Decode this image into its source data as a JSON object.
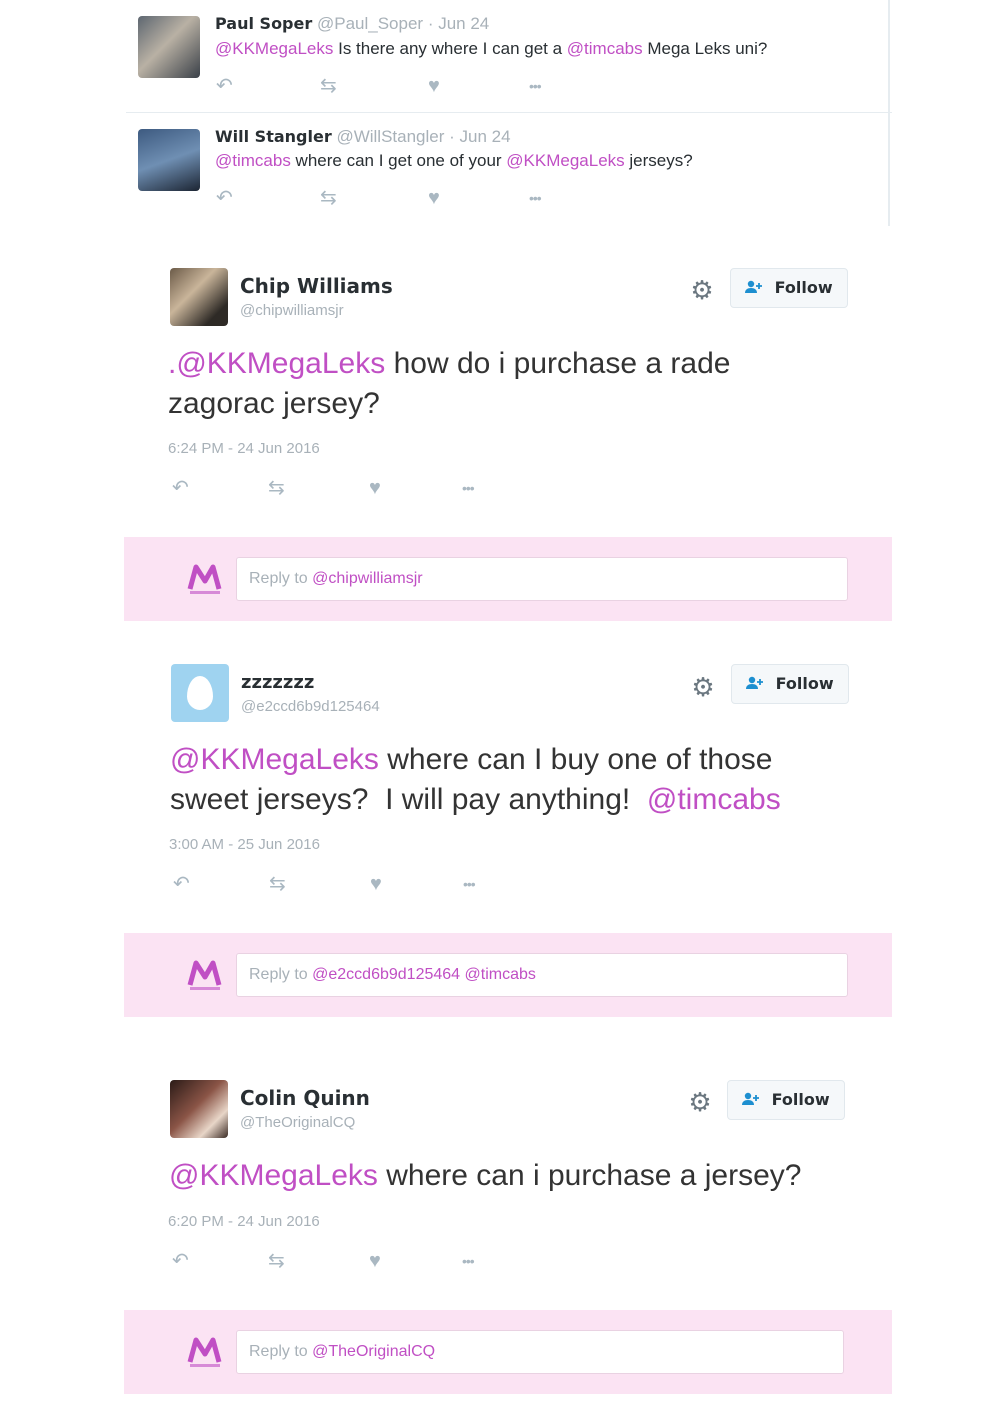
{
  "compact_tweets": [
    {
      "name": "Paul Soper",
      "handle": "@Paul_Soper",
      "date": "· Jun 24",
      "parts": [
        {
          "t": "@KKMegaLeks",
          "m": true
        },
        {
          "t": " Is there any where I can get a ",
          "m": false
        },
        {
          "t": "@timcabs",
          "m": true
        },
        {
          "t": " Mega Leks uni?",
          "m": false
        }
      ]
    },
    {
      "name": "Will Stangler",
      "handle": "@WillStangler",
      "date": "· Jun 24",
      "parts": [
        {
          "t": "@timcabs",
          "m": true
        },
        {
          "t": " where can I get one of your ",
          "m": false
        },
        {
          "t": "@KKMegaLeks",
          "m": true
        },
        {
          "t": " jerseys?",
          "m": false
        }
      ]
    }
  ],
  "big_tweets": [
    {
      "name": "Chip Williams",
      "handle": "@chipwilliamsjr",
      "line1_parts": [
        {
          "t": ".@KKMegaLeks",
          "m": true
        },
        {
          "t": " how do i purchase a rade",
          "m": false
        }
      ],
      "line2_parts": [
        {
          "t": "zagorac jersey?",
          "m": false
        }
      ],
      "time": "6:24 PM - 24 Jun 2016",
      "follow_label": "Follow",
      "reply_prefix": "Reply to ",
      "reply_mentions": "@chipwilliamsjr"
    },
    {
      "name": "zzzzzzz",
      "handle": "@e2ccd6b9d125464",
      "line1_parts": [
        {
          "t": "@KKMegaLeks",
          "m": true
        },
        {
          "t": " where can I buy one of those",
          "m": false
        }
      ],
      "line2_parts": [
        {
          "t": "sweet jerseys?  I will pay anything!  ",
          "m": false
        },
        {
          "t": "@timcabs",
          "m": true
        }
      ],
      "time": "3:00 AM - 25 Jun 2016",
      "follow_label": "Follow",
      "reply_prefix": "Reply to ",
      "reply_mentions": "@e2ccd6b9d125464 @timcabs"
    },
    {
      "name": "Colin Quinn",
      "handle": "@TheOriginalCQ",
      "line1_parts": [
        {
          "t": "@KKMegaLeks",
          "m": true
        },
        {
          "t": " where can i purchase a jersey?",
          "m": false
        }
      ],
      "line2_parts": [],
      "time": "6:20 PM - 24 Jun 2016",
      "follow_label": "Follow",
      "reply_prefix": "Reply to ",
      "reply_mentions": "@TheOriginalCQ"
    }
  ],
  "icons": {
    "reply": "↶",
    "retweet": "⇆",
    "like": "♥",
    "more": "•••",
    "gear": "⚙",
    "follow_user": "👤"
  },
  "colors": {
    "mention": "#c04fc4",
    "reply_band": "#fbe3f3",
    "muted": "#a8b1b8"
  }
}
